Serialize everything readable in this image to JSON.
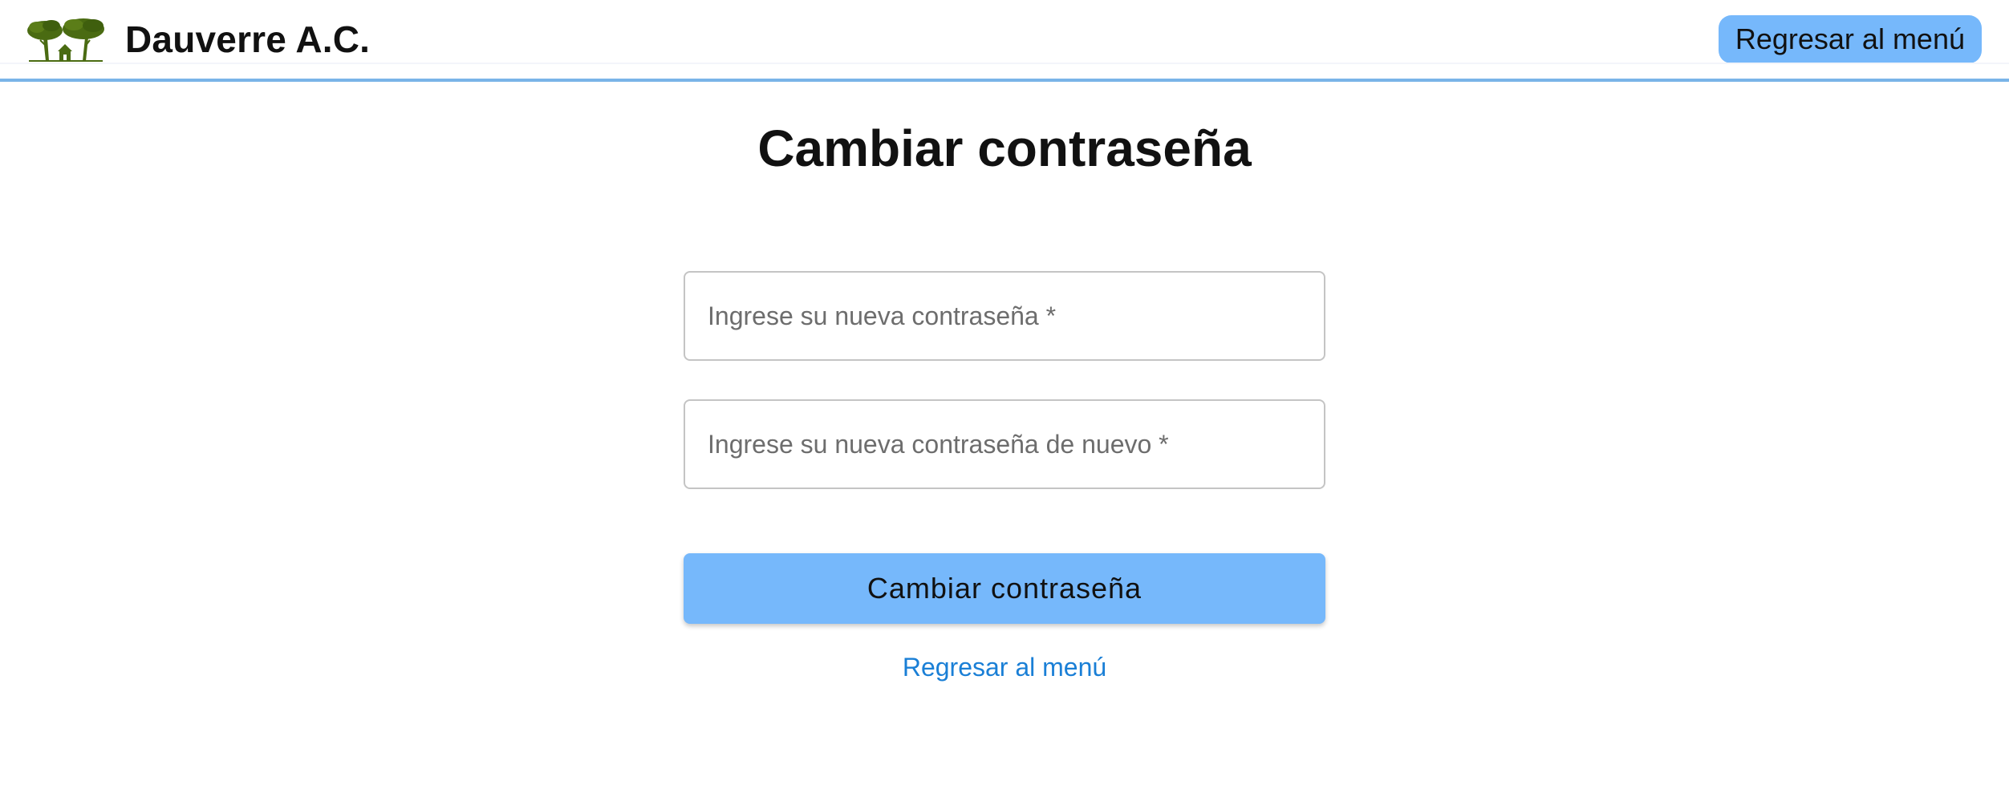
{
  "header": {
    "brand_name": "Dauverre A.C.",
    "logo_icon": "trees-house-logo",
    "back_button_label": "Regresar al menú"
  },
  "main": {
    "title": "Cambiar contraseña",
    "fields": [
      {
        "placeholder": "Ingrese su nueva contraseña *",
        "value": ""
      },
      {
        "placeholder": "Ingrese su nueva contraseña de nuevo *",
        "value": ""
      }
    ],
    "submit_label": "Cambiar contraseña",
    "back_link_label": "Regresar al menú"
  },
  "colors": {
    "accent": "#76b8fb",
    "header_border": "#7ab4e8",
    "link": "#1a7fd6",
    "logo_green": "#4a6b12"
  }
}
